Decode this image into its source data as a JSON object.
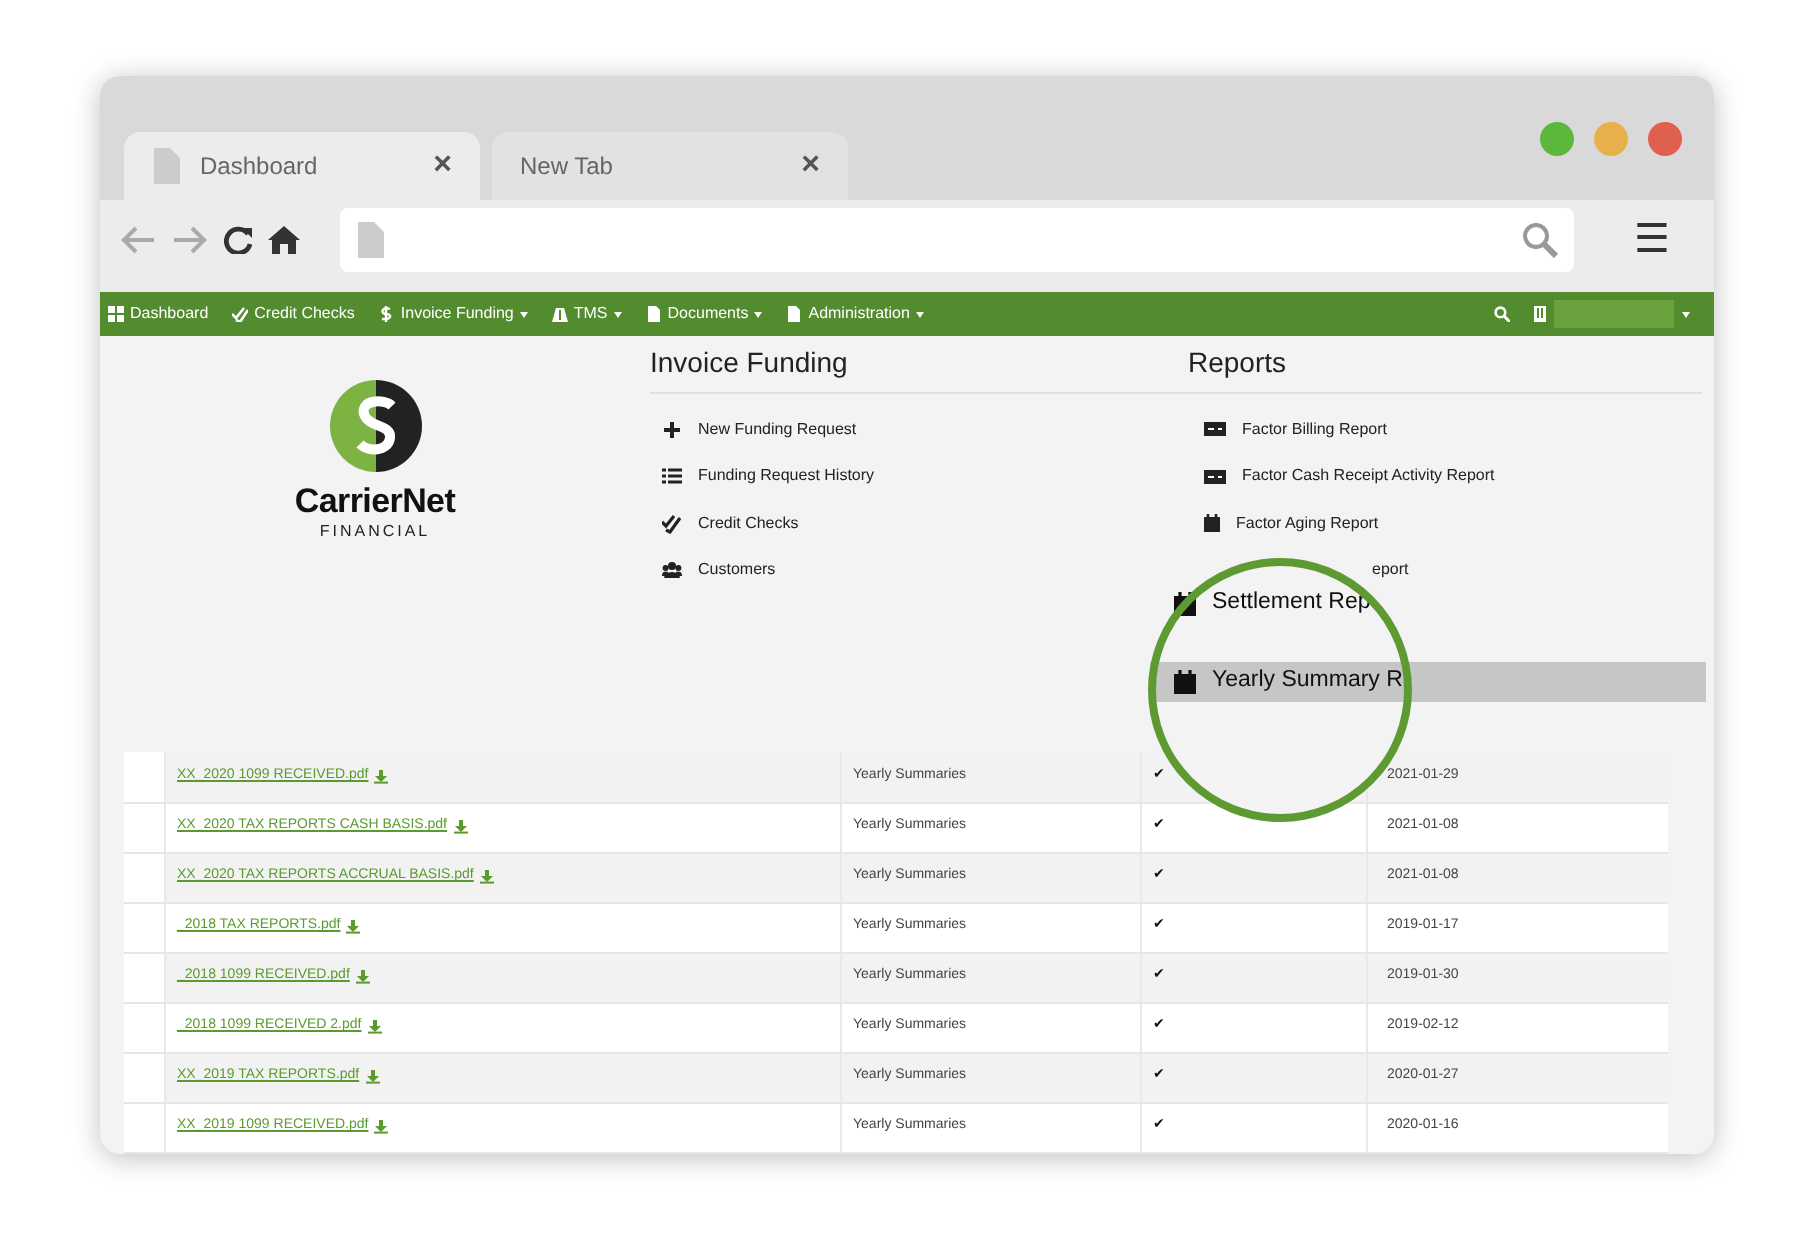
{
  "browser": {
    "tabs": [
      {
        "label": "Dashboard",
        "selected": true,
        "close": "×"
      },
      {
        "label": "New Tab",
        "selected": false,
        "close": "×"
      }
    ],
    "menu": "☰"
  },
  "navbar": {
    "items": [
      {
        "label": "Dashboard",
        "dropdown": false
      },
      {
        "label": "Credit Checks",
        "dropdown": false
      },
      {
        "label": "Invoice Funding",
        "dropdown": true
      },
      {
        "label": "TMS",
        "dropdown": true
      },
      {
        "label": "Documents",
        "dropdown": true
      },
      {
        "label": "Administration",
        "dropdown": true
      }
    ]
  },
  "logo": {
    "name": "CarrierNet",
    "subtitle": "FINANCIAL"
  },
  "invoice_funding": {
    "title": "Invoice Funding",
    "items": [
      "New Funding Request",
      "Funding Request History",
      "Credit Checks",
      "Customers"
    ]
  },
  "reports": {
    "title": "Reports",
    "items": [
      "Factor Billing Report",
      "Factor Cash Receipt Activity Report",
      "Factor Aging Report"
    ],
    "partial_item": "eport"
  },
  "magnifier": {
    "items": [
      {
        "label": "Settlement Rep",
        "selected": false
      },
      {
        "label": "Yearly Summary R",
        "selected": true
      }
    ]
  },
  "table": {
    "rows": [
      {
        "file": "XX_2020 1099 RECEIVED.pdf",
        "category": "Yearly Summaries",
        "mark": "✔",
        "date": "2021-01-29"
      },
      {
        "file": "XX_2020 TAX REPORTS CASH BASIS.pdf",
        "category": "Yearly Summaries",
        "mark": "✔",
        "date": "2021-01-08"
      },
      {
        "file": "XX_2020 TAX REPORTS ACCRUAL BASIS.pdf",
        "category": "Yearly Summaries",
        "mark": "✔",
        "date": "2021-01-08"
      },
      {
        "file": "_2018 TAX REPORTS.pdf",
        "category": "Yearly Summaries",
        "mark": "✔",
        "date": "2019-01-17"
      },
      {
        "file": "_2018 1099 RECEIVED.pdf",
        "category": "Yearly Summaries",
        "mark": "✔",
        "date": "2019-01-30"
      },
      {
        "file": "_2018 1099 RECEIVED 2.pdf",
        "category": "Yearly Summaries",
        "mark": "✔",
        "date": "2019-02-12"
      },
      {
        "file": "XX_2019 TAX REPORTS.pdf",
        "category": "Yearly Summaries",
        "mark": "✔",
        "date": "2020-01-27"
      },
      {
        "file": "XX_2019 1099 RECEIVED.pdf",
        "category": "Yearly Summaries",
        "mark": "✔",
        "date": "2020-01-16"
      }
    ]
  }
}
